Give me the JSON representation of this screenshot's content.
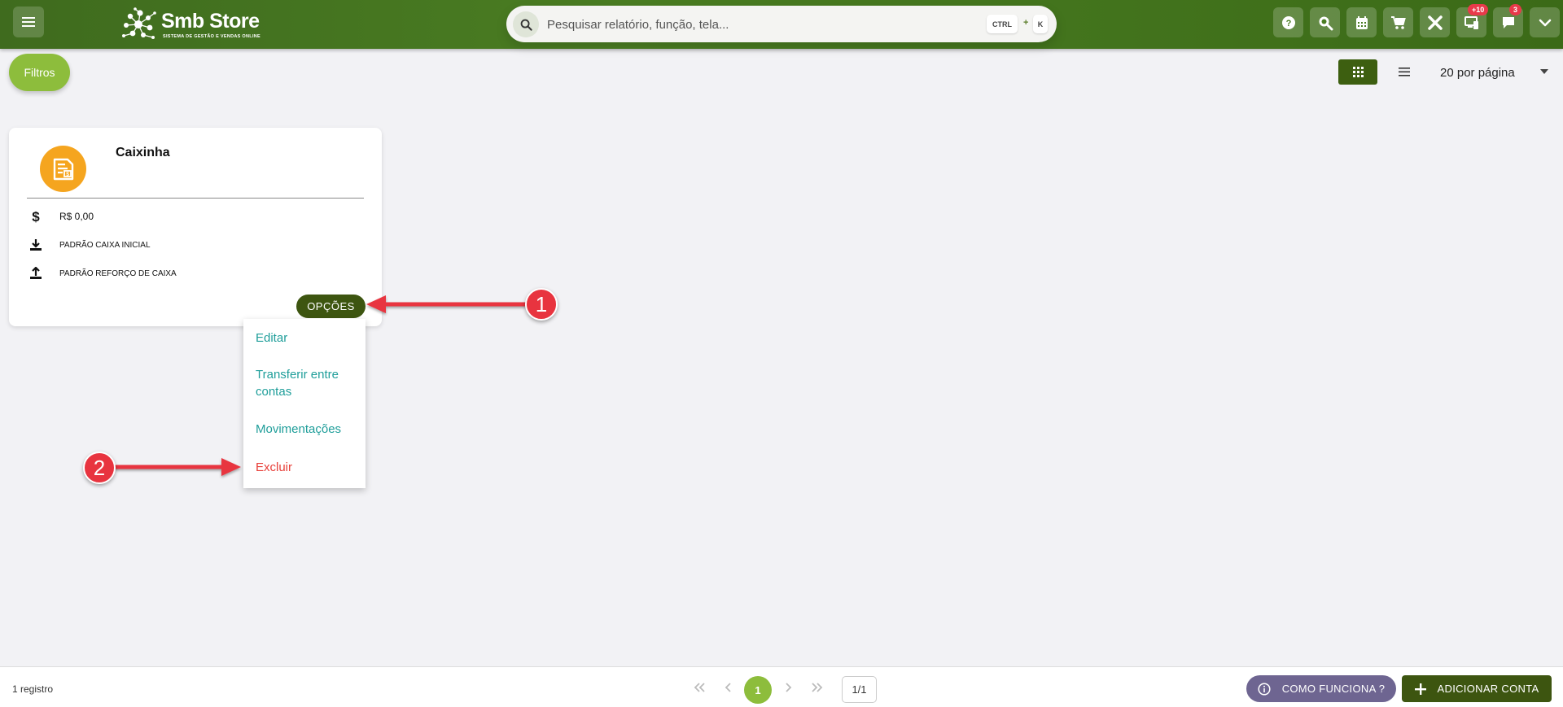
{
  "header": {
    "logo_name": "Smb Store",
    "logo_tagline": "SISTEMA DE GESTÃO E VENDAS ONLINE",
    "search_placeholder": "Pesquisar relatório, função, tela...",
    "shortcut_key1": "CTRL",
    "shortcut_plus": "+",
    "shortcut_key2": "K",
    "icons": [
      "help-icon",
      "search-zoom-icon",
      "calendar-icon",
      "cart-icon",
      "tools-icon",
      "pos-terminal-icon",
      "chat-icon",
      "chevron-down-icon"
    ],
    "badge_pos": "+10",
    "badge_chat": "3"
  },
  "toolbar": {
    "filters_label": "Filtros",
    "per_page_label": "20 por página"
  },
  "card": {
    "title": "Caixinha",
    "balance": "R$ 0,00",
    "initial_cash": "PADRÃO CAIXA INICIAL",
    "reinforce_cash": "PADRÃO REFORÇO DE CAIXA",
    "options_label": "OPÇÕES"
  },
  "dropdown": {
    "items": [
      "Editar",
      "Transferir entre contas",
      "Movimentações",
      "Excluir"
    ]
  },
  "annotations": {
    "step1": "1",
    "step2": "2"
  },
  "footer": {
    "record_count": "1 registro",
    "current_page": "1",
    "page_total": "1/1",
    "how_it_works_label": "COMO FUNCIONA ?",
    "add_account_label": "ADICIONAR CONTA"
  },
  "colors": {
    "header_green": "#4a7d22",
    "accent_dark_green": "#3d5510",
    "light_green": "#8dbd3c",
    "card_icon_orange": "#f5a51f",
    "menu_link_teal": "#1f9e9a",
    "danger_red": "#e8403a",
    "callout_red": "#e8343f",
    "purple_button": "#6e6591"
  }
}
